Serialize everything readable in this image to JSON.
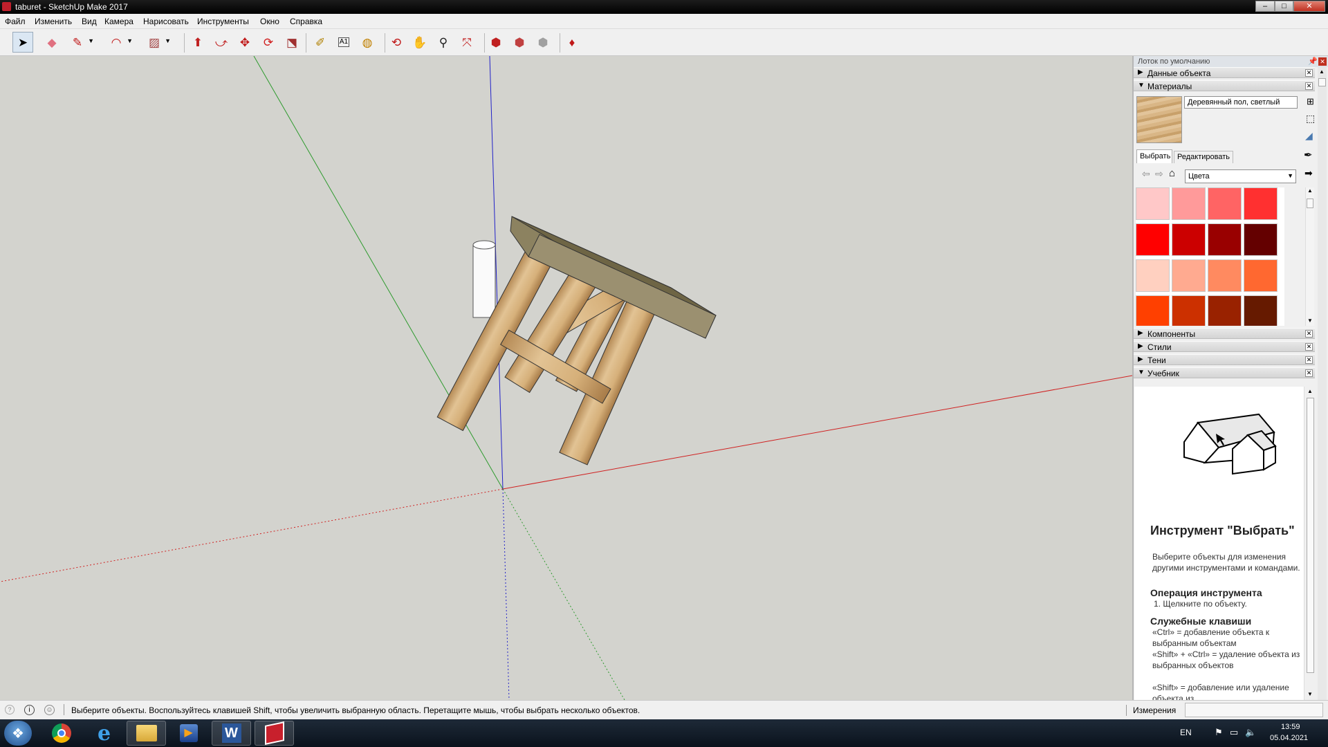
{
  "window": {
    "title": "taburet - SketchUp Make 2017",
    "minimize": "–",
    "maximize": "□",
    "close": "✕"
  },
  "menu": [
    "Файл",
    "Изменить",
    "Вид",
    "Камера",
    "Нарисовать",
    "Инструменты",
    "Окно",
    "Справка"
  ],
  "toolbar": [
    {
      "name": "select-tool",
      "icon": "arrow-cursor-icon",
      "glyph": "➤",
      "color": "#000000"
    },
    {
      "name": "eraser-tool",
      "icon": "eraser-icon",
      "glyph": "◆",
      "color": "#e07080"
    },
    {
      "name": "line-tool",
      "icon": "pencil-icon",
      "glyph": "✎",
      "color": "#c01818"
    },
    {
      "name": "arc-tool",
      "icon": "arc-icon",
      "glyph": "◠",
      "color": "#c01818"
    },
    {
      "name": "shape-tool",
      "icon": "rectangle-icon",
      "glyph": "▨",
      "color": "#a04040"
    },
    {
      "name": "push-pull-tool",
      "icon": "push-pull-icon",
      "glyph": "⬆",
      "color": "#c02020"
    },
    {
      "name": "follow-me-tool",
      "icon": "follow-me-icon",
      "glyph": "⤻",
      "color": "#c02020"
    },
    {
      "name": "move-tool",
      "icon": "move-icon",
      "glyph": "✥",
      "color": "#c01818"
    },
    {
      "name": "rotate-tool",
      "icon": "rotate-icon",
      "glyph": "⟳",
      "color": "#d02020"
    },
    {
      "name": "scale-tool",
      "icon": "scale-icon",
      "glyph": "⬔",
      "color": "#a03030"
    },
    {
      "name": "tape-measure-tool",
      "icon": "tape-measure-icon",
      "glyph": "✐",
      "color": "#b08000"
    },
    {
      "name": "text-tool",
      "icon": "text-icon",
      "glyph": "A1",
      "color": "#000000"
    },
    {
      "name": "paint-bucket-tool",
      "icon": "paint-bucket-icon",
      "glyph": "◍",
      "color": "#c08000"
    },
    {
      "name": "orbit-tool",
      "icon": "orbit-icon",
      "glyph": "⟲",
      "color": "#c01818"
    },
    {
      "name": "pan-tool",
      "icon": "hand-icon",
      "glyph": "✋",
      "color": "#d4a040"
    },
    {
      "name": "zoom-tool",
      "icon": "magnifier-icon",
      "glyph": "⚲",
      "color": "#202020"
    },
    {
      "name": "zoom-extents-tool",
      "icon": "zoom-extents-icon",
      "glyph": "⤧",
      "color": "#c01818"
    },
    {
      "name": "warehouse-tool",
      "icon": "3d-warehouse-icon",
      "glyph": "⬢",
      "color": "#c02020"
    },
    {
      "name": "extension-warehouse-tool",
      "icon": "extension-warehouse-icon",
      "glyph": "⬢",
      "color": "#c04040"
    },
    {
      "name": "share-model-tool",
      "icon": "share-model-icon",
      "glyph": "⬢",
      "color": "#a0a0a0"
    },
    {
      "name": "extension-manager-tool",
      "icon": "ruby-gem-icon",
      "glyph": "♦",
      "color": "#c01818"
    }
  ],
  "panel": {
    "tray_title": "Лоток по умолчанию",
    "entity_info": "Данные объекта",
    "materials": "Материалы",
    "material_name": "Деревянный пол, светлый",
    "tab_select": "Выбрать",
    "tab_edit": "Редактировать",
    "collection": "Цвета",
    "swatches": [
      "#ffc8c8",
      "#ff9a9a",
      "#ff6464",
      "#ff3030",
      "#ff0000",
      "#cc0000",
      "#990000",
      "#640000",
      "#ffd0c0",
      "#ffaa90",
      "#ff8a60",
      "#ff6830",
      "#ff4000",
      "#cc3000",
      "#992200",
      "#661a00"
    ],
    "components": "Компоненты",
    "styles": "Стили",
    "shadows": "Тени",
    "instructor": "Учебник",
    "tut_title": "Инструмент \"Выбрать\"",
    "tut_desc": "Выберите объекты для изменения другими инструментами и командами.",
    "tut_op_title": "Операция инструмента",
    "tut_op_1": "1. Щелкните по объекту.",
    "tut_keys_title": "Служебные клавиши",
    "tut_key_1": "«Ctrl» = добавление объекта к выбранным объектам",
    "tut_key_2": "«Shift» + «Ctrl» = удаление объекта из выбранных объектов",
    "tut_key_3": "«Shift» = добавление или удаление объекта из"
  },
  "status": {
    "text": "Выберите объекты. Воспользуйтесь клавишей Shift, чтобы увеличить выбранную область. Перетащите мышь, чтобы выбрать несколько объектов.",
    "measure_label": "Измерения"
  },
  "taskbar": {
    "lang": "EN",
    "time": "13:59",
    "date": "05.04.2021"
  }
}
